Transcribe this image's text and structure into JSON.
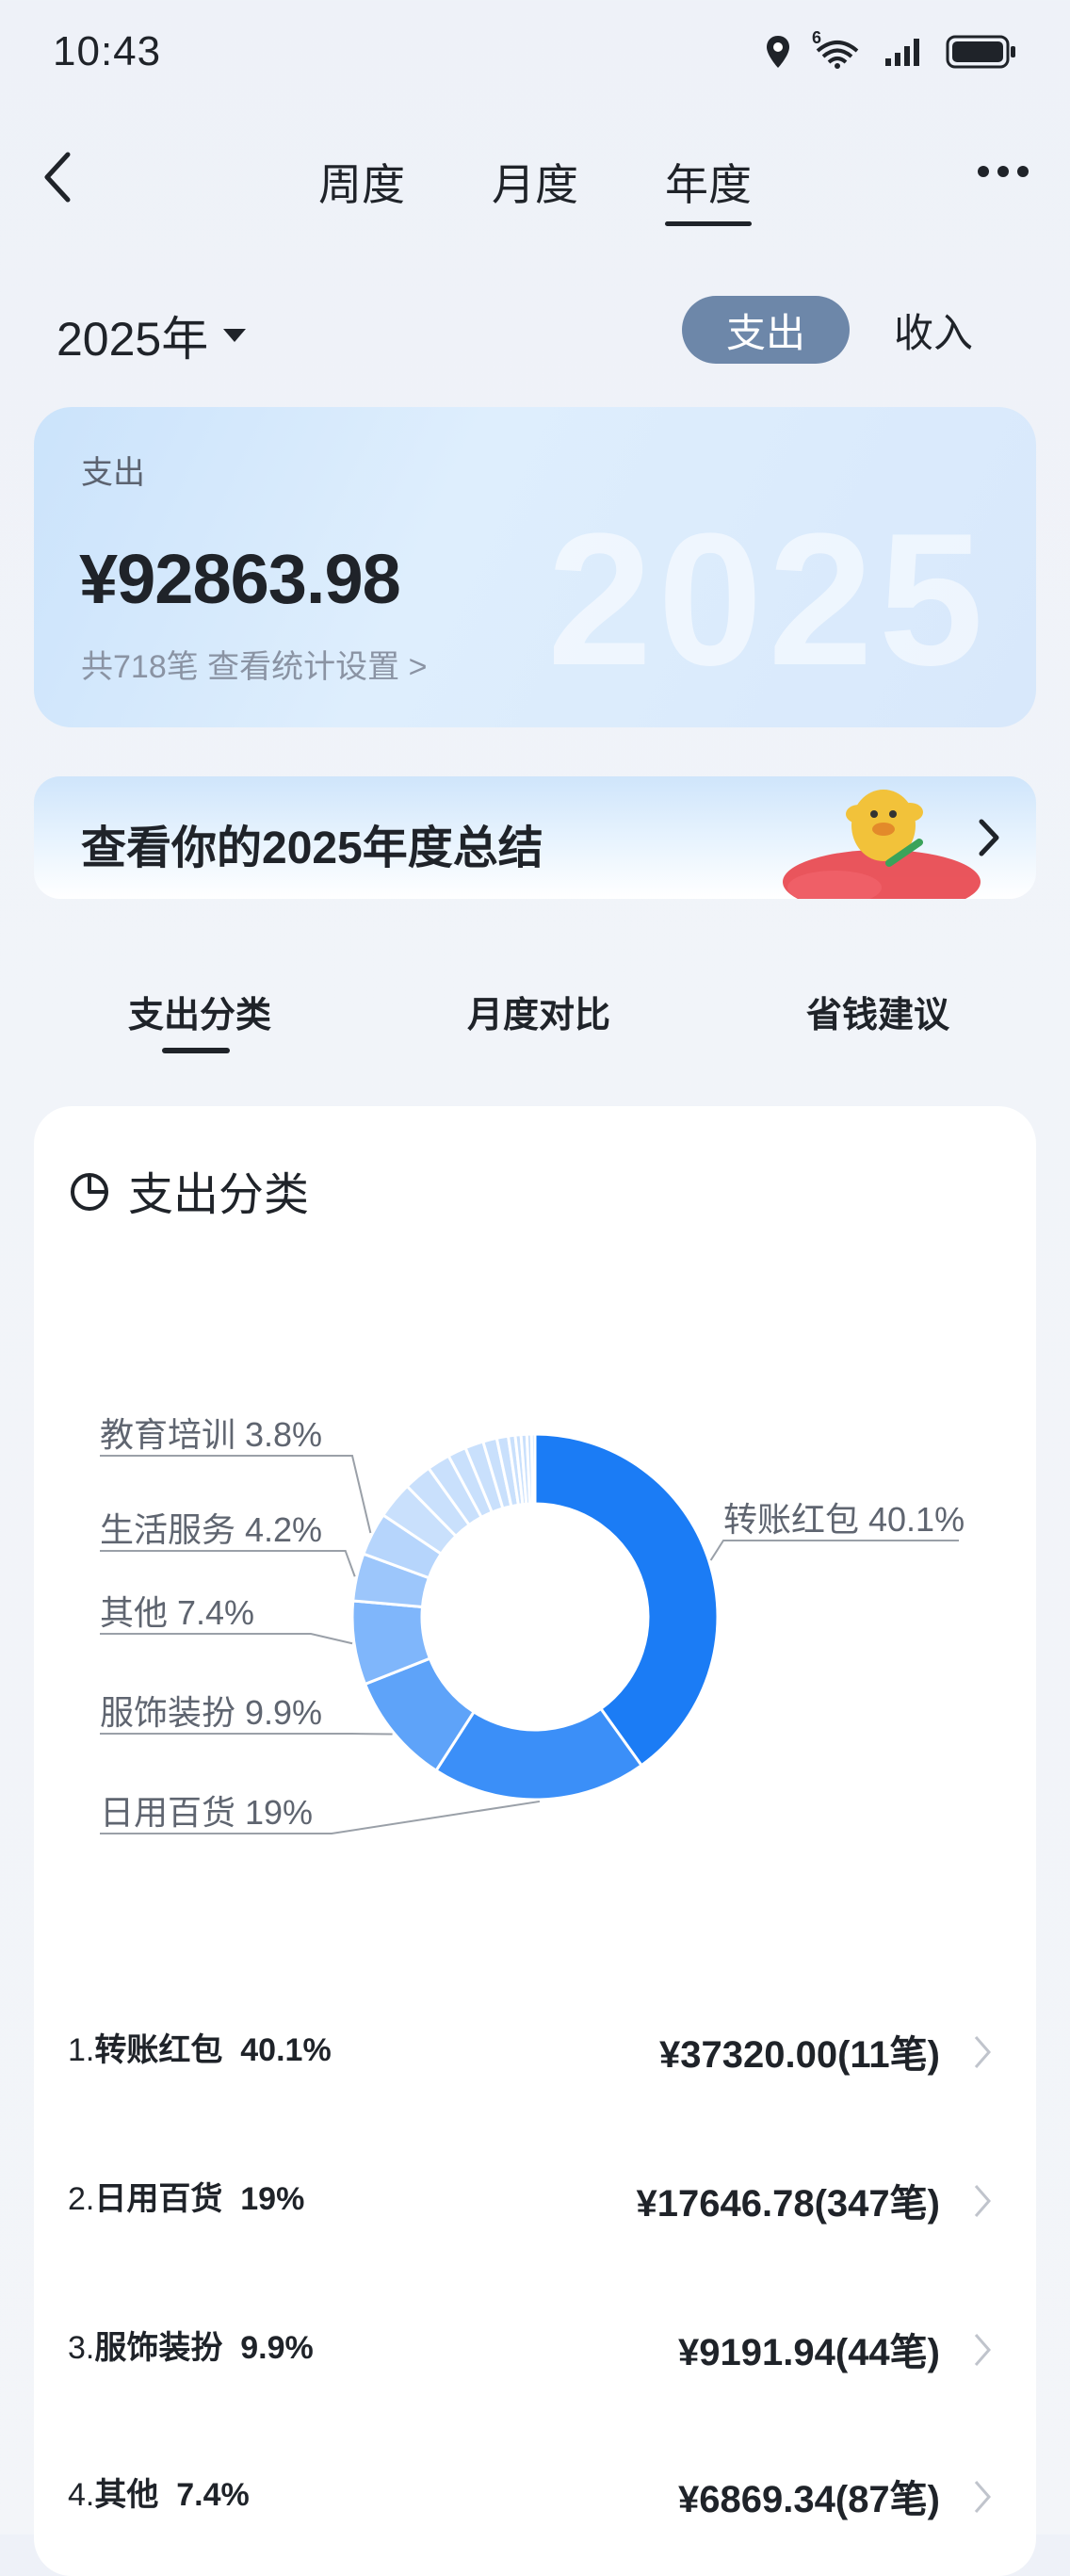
{
  "status": {
    "time": "10:43",
    "network": "6"
  },
  "nav": {
    "tabs": [
      "周度",
      "月度",
      "年度"
    ],
    "active_tab": "年度"
  },
  "filter": {
    "year": "2025年",
    "types": [
      "支出",
      "收入"
    ],
    "active_type": "支出"
  },
  "summary": {
    "label": "支出",
    "amount": "¥92863.98",
    "sub": "共718笔  查看统计设置 >",
    "watermark": "2025"
  },
  "banner": {
    "text": "查看你的2025年度总结"
  },
  "subtabs": [
    "支出分类",
    "月度对比",
    "省钱建议"
  ],
  "category_card": {
    "title": "支出分类"
  },
  "chart_data": {
    "type": "pie",
    "labels": [
      "转账红包",
      "日用百货",
      "服饰装扮",
      "其他",
      "生活服务",
      "教育培训"
    ],
    "values": [
      40.1,
      19,
      9.9,
      7.4,
      4.2,
      3.8
    ],
    "data_labels": [
      "转账红包 40.1%",
      "日用百货 19%",
      "服饰装扮 9.9%",
      "其他 7.4%",
      "生活服务 4.2%",
      "教育培训 3.8%"
    ],
    "colors": [
      "#1b7cf5",
      "#3b8ff8",
      "#5ea3f9",
      "#7fb6fb",
      "#9cc6fb",
      "#b6d5fc"
    ]
  },
  "list": [
    {
      "index": "1.",
      "name": "转账红包",
      "pct": "40.1%",
      "value": "¥37320.00(11笔)"
    },
    {
      "index": "2.",
      "name": "日用百货",
      "pct": "19%",
      "value": "¥17646.78(347笔)"
    },
    {
      "index": "3.",
      "name": "服饰装扮",
      "pct": "9.9%",
      "value": "¥9191.94(44笔)"
    },
    {
      "index": "4.",
      "name": "其他",
      "pct": "7.4%",
      "value": "¥6869.34(87笔)"
    }
  ]
}
